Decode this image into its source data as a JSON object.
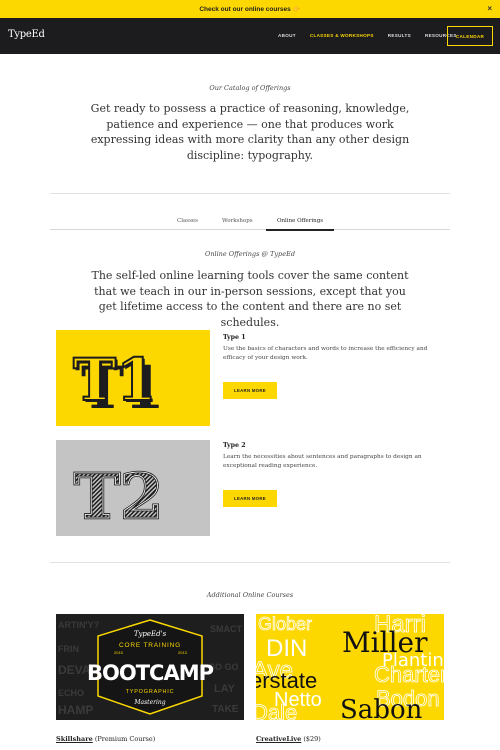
{
  "banner": {
    "text": "Check out our online courses 👉",
    "close": "×"
  },
  "nav": {
    "logo": "TypeEd",
    "links": [
      "ABOUT",
      "CLASSES & WORKSHOPS",
      "RESULTS",
      "RESOURCES"
    ],
    "active_index": 1,
    "cta": "CALENDAR"
  },
  "catalog": {
    "kicker": "Our Catalog of Offerings",
    "lead": "Get ready to possess a practice of reasoning, knowledge, patience and experience — one that produces work expressing ideas with more clarity than any other design discipline: typography."
  },
  "tabs": [
    {
      "label": "Classes"
    },
    {
      "label": "Workshops"
    },
    {
      "label": "Online Offerings",
      "active": true
    }
  ],
  "online": {
    "kicker": "Online Offerings @ TypeEd",
    "lead": "The self-led online learning tools cover the same content that we teach in our in-person sessions, except that you get lifetime access to the content and there are no set schedules."
  },
  "courses": [
    {
      "badge": "T1",
      "title": "Type 1",
      "description": "Use the basics of characters and words to increase the efficiency and efficacy of your design work.",
      "button": "LEARN MORE",
      "bg": "#fcd800"
    },
    {
      "badge": "T2",
      "title": "Type 2",
      "description": "Learn the necessities about sentences and paragraphs to design an exceptional reading experience.",
      "button": "LEARN MORE",
      "bg": "#c4c4c4"
    }
  ],
  "additional": {
    "kicker": "Additional Online Courses",
    "items": [
      {
        "name": "Skillshare",
        "note": "(Premium Course)",
        "art": {
          "top": "TypeEd's",
          "sub": "CORE TRAINING",
          "year_left": "2015",
          "year_right": "2013",
          "main": "BOOTCAMP",
          "caption": "TYPOGRAPHIC",
          "footer": "Mastering",
          "bg_words": [
            "ARTIN'Y?",
            "FRIN",
            "ECHO",
            "DEVAL",
            "HAMP",
            "SMACT",
            "GO GO",
            "LAY",
            "TAKE"
          ]
        }
      },
      {
        "name": "CreativeLive",
        "note": "($29)",
        "art": {
          "words": [
            "Glober",
            "Harri",
            "DIN",
            "Miller",
            "Plantin",
            "Ave",
            "Charter",
            "erstate",
            "Netto",
            "Bodon",
            "Sabon",
            "Dale"
          ]
        }
      }
    ]
  },
  "colors": {
    "accent": "#fcd800",
    "dark": "#1c1c1e"
  }
}
